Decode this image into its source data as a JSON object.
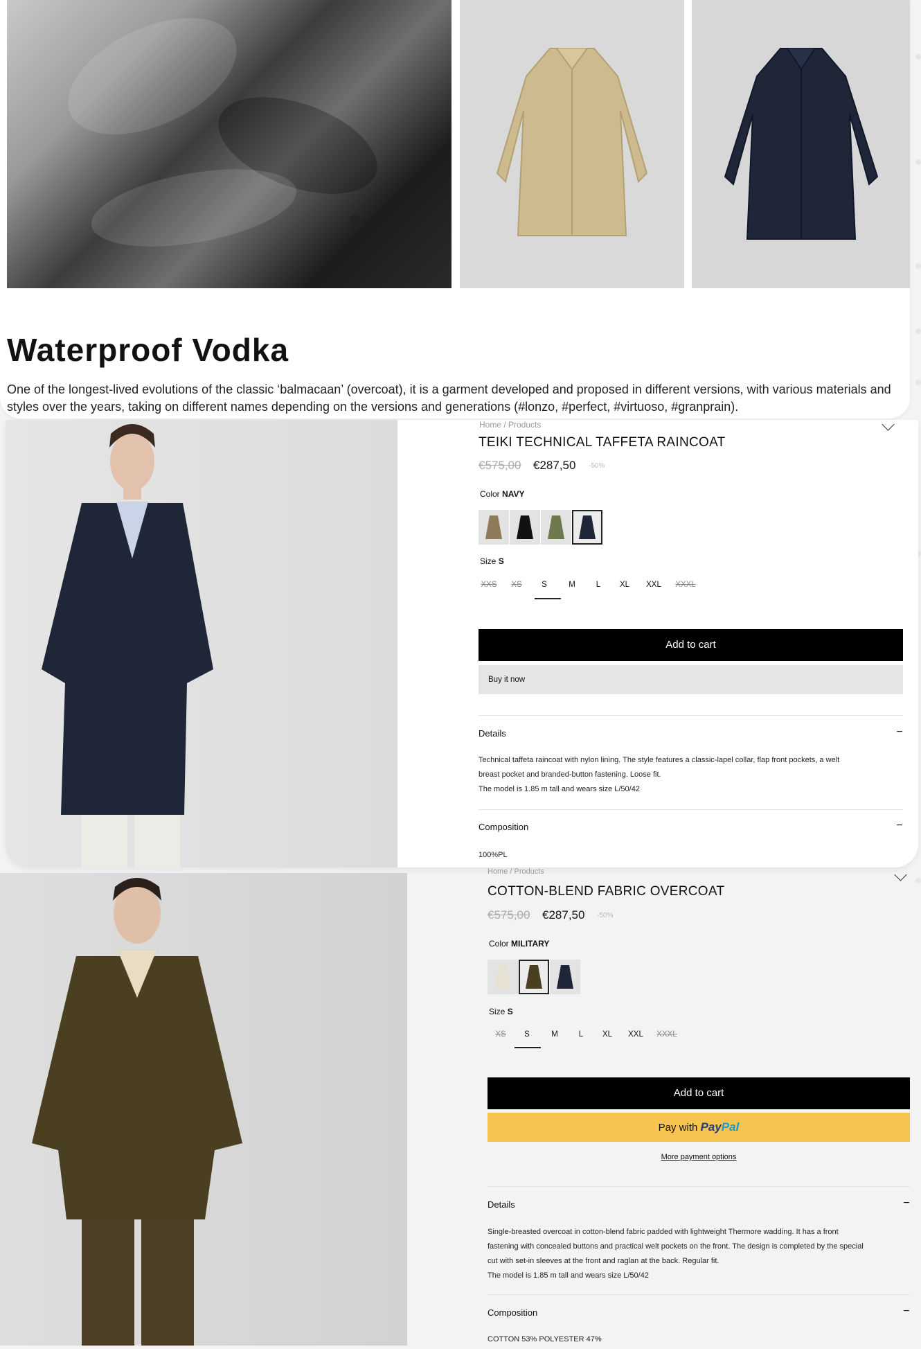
{
  "collection": {
    "title": "Waterproof Vodka",
    "description": "One of the longest-lived evolutions of the classic ‘balmacaan’ (overcoat), it is a garment developed and proposed in different versions, with various materials and styles over the years, taking on different names depending on the versions and generations (#lonzo, #perfect, #virtuoso, #granprain)."
  },
  "product1": {
    "breadcrumb": "Home / Products",
    "title": "TEIKI TECHNICAL TAFFETA RAINCOAT",
    "old_price": "€575,00",
    "price": "€287,50",
    "discount": "-50%",
    "color_label": "Color",
    "color_value": "NAVY",
    "swatch_names": [
      "beige-swatch",
      "black-swatch",
      "green-swatch",
      "navy-swatch"
    ],
    "selected_swatch": 3,
    "size_label": "Size",
    "size_value": "S",
    "sizes": [
      "XXS",
      "XS",
      "S",
      "M",
      "L",
      "XL",
      "XXL",
      "XXXL"
    ],
    "sizes_unavailable": [
      "XXS",
      "XS",
      "XXXL"
    ],
    "add_to_cart": "Add to cart",
    "buy_now": "Buy it now",
    "details_title": "Details",
    "details_text": [
      "Technical taffeta raincoat with nylon lining. The style features a classic-lapel collar, flap front pockets, a welt",
      "breast pocket and branded-button fastening. Loose fit.",
      "The model is 1.85 m tall and wears size L/50/42"
    ],
    "composition_title": "Composition",
    "composition_text": "100%PL",
    "toggle": "−"
  },
  "product2": {
    "breadcrumb": "Home / Products",
    "title": "COTTON-BLEND FABRIC OVERCOAT",
    "old_price": "€575,00",
    "price": "€287,50",
    "discount": "-50%",
    "color_label": "Color",
    "color_value": "MILITARY",
    "selected_swatch": 1,
    "size_label": "Size",
    "size_value": "S",
    "sizes": [
      "XS",
      "S",
      "M",
      "L",
      "XL",
      "XXL",
      "XXXL"
    ],
    "sizes_unavailable": [
      "XS",
      "XXXL"
    ],
    "add_to_cart": "Add to cart",
    "paypal_prefix": "Pay with",
    "paypal_brand_1": "Pay",
    "paypal_brand_2": "Pal",
    "more_options": "More payment options",
    "details_title": "Details",
    "details_text": [
      "Single-breasted overcoat in cotton-blend fabric padded with lightweight Thermore wadding. It has a front",
      "fastening with concealed buttons and practical welt pockets on the front. The design is completed by the special",
      "cut with set-in sleeves at the front and raglan at the back. Regular fit.",
      "The model is 1.85 m tall and wears size L/50/42"
    ],
    "composition_title": "Composition",
    "composition_text": "COTTON 53% POLYESTER 47%",
    "toggle": "−"
  },
  "colors": {
    "navy": "#1e2638",
    "beige": "#cdbb8f",
    "military": "#4a3f20",
    "black": "#000000",
    "paypal": "#f5c451"
  }
}
